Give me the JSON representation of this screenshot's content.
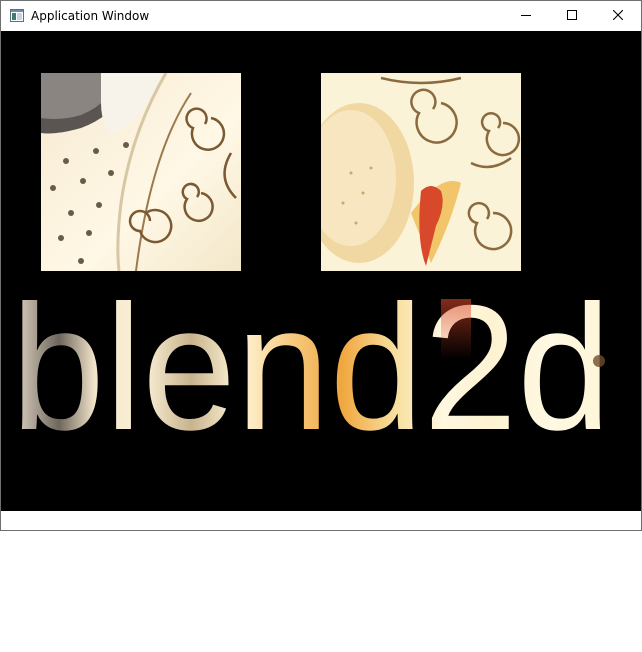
{
  "window": {
    "title": "Application Window",
    "icon": "app-window-icon",
    "controls": {
      "minimize": "minimize-icon",
      "maximize": "maximize-icon",
      "close": "close-icon"
    }
  },
  "canvas": {
    "background": "#000000",
    "text": "blend2d",
    "colors": {
      "cream": "#fbf4d6",
      "light": "#fffbe8",
      "brown": "#6e4d2a",
      "gray": "#4e4a48",
      "orange": "#f3a33a",
      "red": "#d8482a"
    }
  }
}
